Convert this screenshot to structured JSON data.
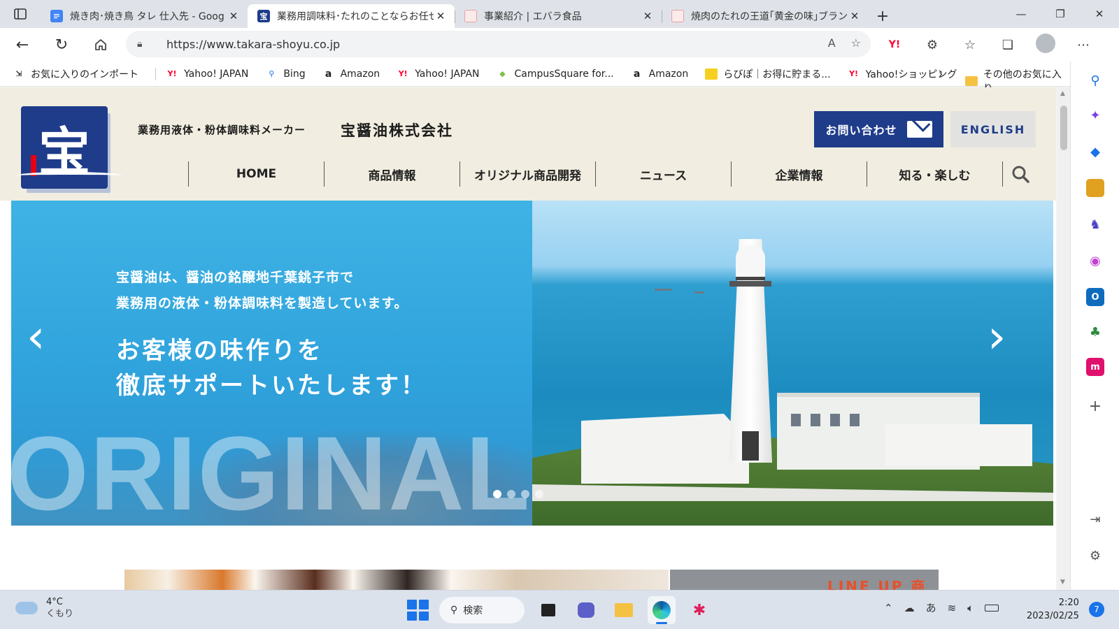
{
  "browser": {
    "tabs": [
      {
        "title": "焼き肉･焼き鳥 タレ 仕入先 - Goog",
        "favicon": "docs-icon",
        "active": false
      },
      {
        "title": "業務用調味料･たれのことならお任せ",
        "favicon": "takara-icon",
        "active": true
      },
      {
        "title": "事業紹介 | エバラ食品",
        "favicon": "ebara-icon",
        "active": false
      },
      {
        "title": "焼肉のたれの王道｢黄金の味｣ブラン",
        "favicon": "ebara-icon",
        "active": false
      }
    ],
    "url": "https://www.takara-shoyu.co.jp",
    "favorites": [
      {
        "label": "お気に入りのインポート",
        "icon": "import-icon"
      },
      {
        "label": "Yahoo! JAPAN",
        "icon": "yahoo-icon"
      },
      {
        "label": "Bing",
        "icon": "bing-icon"
      },
      {
        "label": "Amazon",
        "icon": "amazon-icon"
      },
      {
        "label": "Yahoo! JAPAN",
        "icon": "yahoo-icon"
      },
      {
        "label": "CampusSquare for...",
        "icon": "campus-icon"
      },
      {
        "label": "Amazon",
        "icon": "amazon-icon"
      },
      {
        "label": "らびぽ｜お得に貯まる...",
        "icon": "rabipo-icon"
      },
      {
        "label": "Yahoo!ショッピング",
        "icon": "yahoo-icon"
      }
    ],
    "other_favorites": "その他のお気に入り",
    "yahoo_short": "Y!",
    "amazon_short": "a"
  },
  "site": {
    "tagline": "業務用液体・粉体調味料メーカー",
    "company": "宝醤油株式会社",
    "logo_mark": "宝",
    "contact_label": "お問い合わせ",
    "english_label": "ENGLISH",
    "nav": [
      "HOME",
      "商品情報",
      "オリジナル商品開発",
      "ニュース",
      "企業情報",
      "知る・楽しむ"
    ],
    "hero": {
      "kicker_1": "宝醤油は、醤油の銘醸地千葉銚子市で",
      "kicker_2": "業務用の液体・粉体調味料を製造しています。",
      "headline_1": "お客様の味作りを",
      "headline_2": "徹底サポートいたします！",
      "bg_word": "ORIGINAL",
      "slide_count": 4,
      "active_slide": 1
    },
    "lineup_label": "LINE UP 商"
  },
  "taskbar": {
    "temperature": "4°C",
    "weather": "くもり",
    "search_label": "検索",
    "ime": "あ",
    "time": "2:20",
    "date": "2023/02/25",
    "notifications": "7"
  },
  "colors": {
    "brand_navy": "#1e3c8a",
    "header_bg": "#f1ede0",
    "hero_blue": "#3fb3e4",
    "accent_red": "#e60012",
    "windows_blue": "#1a73e8"
  }
}
